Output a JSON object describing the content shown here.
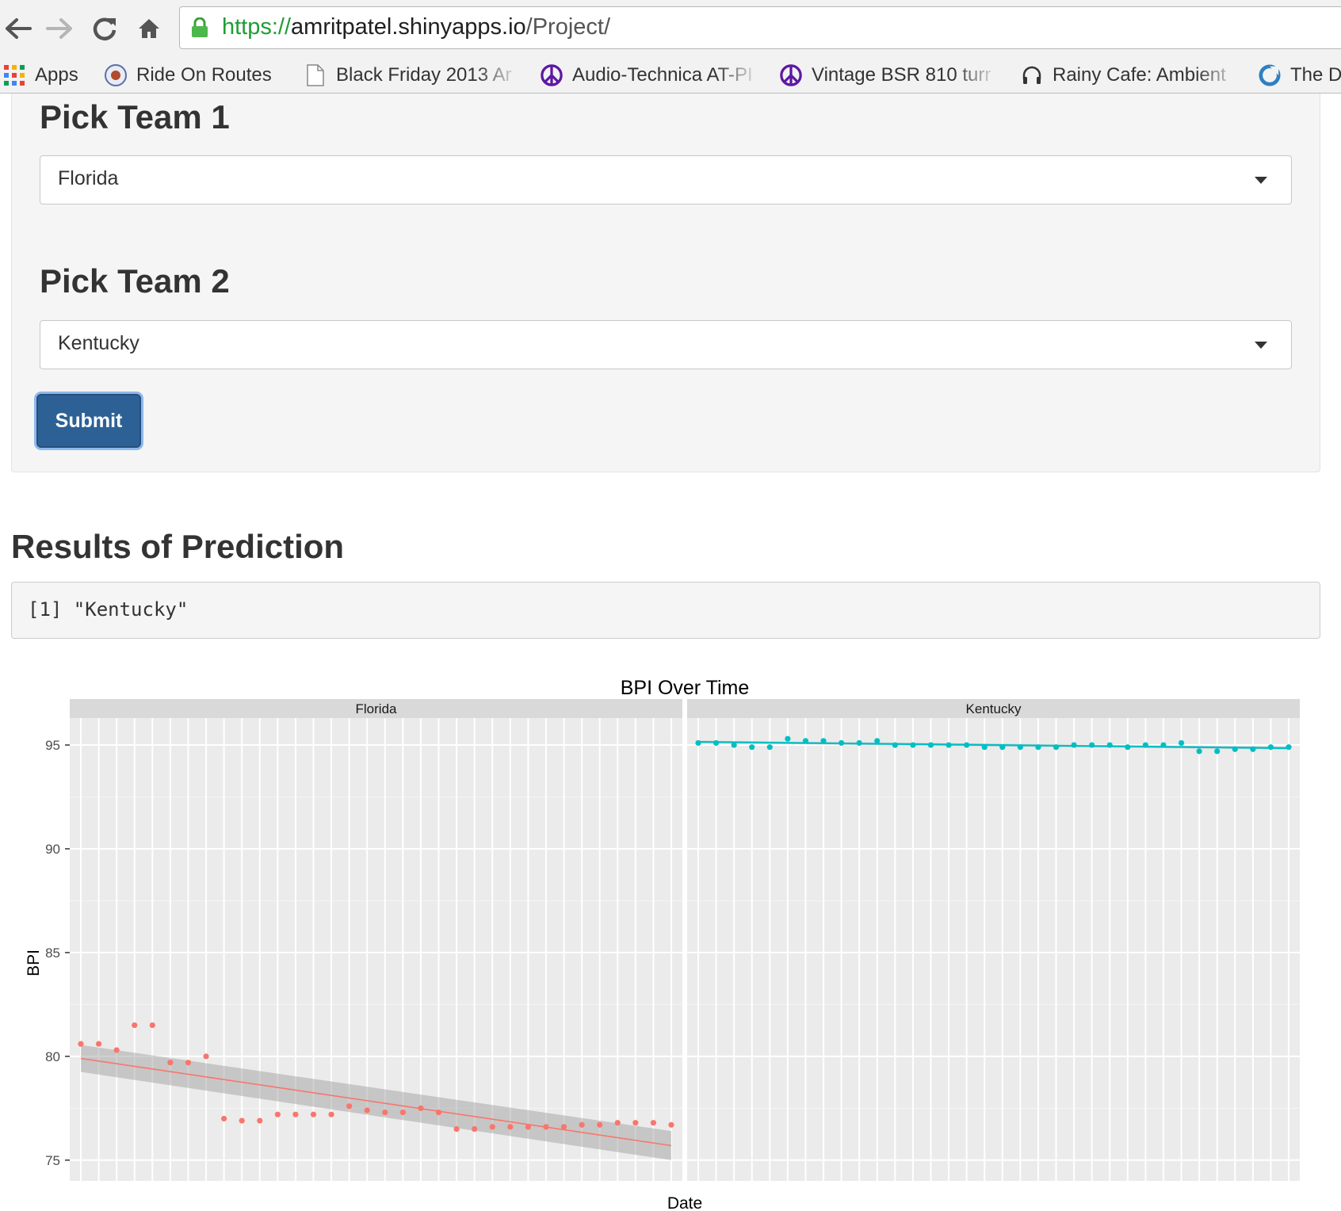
{
  "browser": {
    "url_scheme": "https://",
    "url_host": "amritpatel.shinyapps.io",
    "url_path": "/Project/",
    "nav": {
      "back": "back-icon",
      "forward": "forward-icon",
      "reload": "reload-icon",
      "home": "home-icon"
    },
    "bookmarks": [
      {
        "label": "Apps",
        "icon": "apps-grid-icon"
      },
      {
        "label": "Ride On Routes",
        "icon": "ride-on-seal-icon"
      },
      {
        "label": "Black Friday 2013 Ar",
        "icon": "document-icon"
      },
      {
        "label": "Audio-Technica AT-PI",
        "icon": "peace-icon"
      },
      {
        "label": "Vintage BSR 810 turr",
        "icon": "peace-icon"
      },
      {
        "label": "Rainy Cafe: Ambient",
        "icon": "headphones-icon"
      },
      {
        "label": "The D",
        "icon": "blue-circle-icon"
      }
    ]
  },
  "form": {
    "team1_label": "Pick Team 1",
    "team1_value": "Florida",
    "team2_label": "Pick Team 2",
    "team2_value": "Kentucky",
    "submit_label": "Submit"
  },
  "results": {
    "title": "Results of Prediction",
    "output": "[1] \"Kentucky\""
  },
  "chart_data": {
    "type": "scatter",
    "title": "BPI Over Time",
    "xlabel": "Date",
    "ylabel": "BPI",
    "ylim": [
      74,
      96.3
    ],
    "yticks": [
      75,
      80,
      85,
      90,
      95
    ],
    "grid": true,
    "facets": [
      "Florida",
      "Kentucky"
    ],
    "x_tick_count": 34,
    "series": [
      {
        "name": "Florida",
        "color": "#f8766d",
        "x": [
          1,
          2,
          3,
          4,
          5,
          6,
          7,
          8,
          9,
          10,
          11,
          12,
          13,
          14,
          15,
          16,
          17,
          18,
          19,
          20,
          21,
          22,
          23,
          24,
          25,
          26,
          27,
          28,
          29,
          30,
          31,
          32,
          33,
          34
        ],
        "values": [
          80.6,
          80.6,
          80.3,
          81.5,
          81.5,
          79.7,
          79.7,
          80.0,
          77.0,
          76.9,
          76.9,
          77.2,
          77.2,
          77.2,
          77.2,
          77.6,
          77.4,
          77.3,
          77.3,
          77.5,
          77.3,
          76.5,
          76.5,
          76.6,
          76.6,
          76.6,
          76.6,
          76.6,
          76.7,
          76.7,
          76.8,
          76.8,
          76.8,
          76.7
        ],
        "trend": [
          79.9,
          75.7
        ],
        "band": [
          0.65,
          0.7
        ]
      },
      {
        "name": "Kentucky",
        "color": "#00bfc4",
        "x": [
          1,
          2,
          3,
          4,
          5,
          6,
          7,
          8,
          9,
          10,
          11,
          12,
          13,
          14,
          15,
          16,
          17,
          18,
          19,
          20,
          21,
          22,
          23,
          24,
          25,
          26,
          27,
          28,
          29,
          30,
          31,
          32,
          33,
          34
        ],
        "values": [
          95.1,
          95.1,
          95.0,
          94.9,
          94.9,
          95.3,
          95.2,
          95.2,
          95.1,
          95.1,
          95.2,
          95.0,
          95.0,
          95.0,
          95.0,
          95.0,
          94.9,
          94.9,
          94.9,
          94.9,
          94.9,
          95.0,
          95.0,
          95.0,
          94.9,
          95.0,
          95.0,
          95.1,
          94.7,
          94.7,
          94.8,
          94.8,
          94.9,
          94.9
        ],
        "trend": [
          95.15,
          94.85
        ],
        "band": [
          0.06,
          0.06
        ]
      }
    ]
  }
}
